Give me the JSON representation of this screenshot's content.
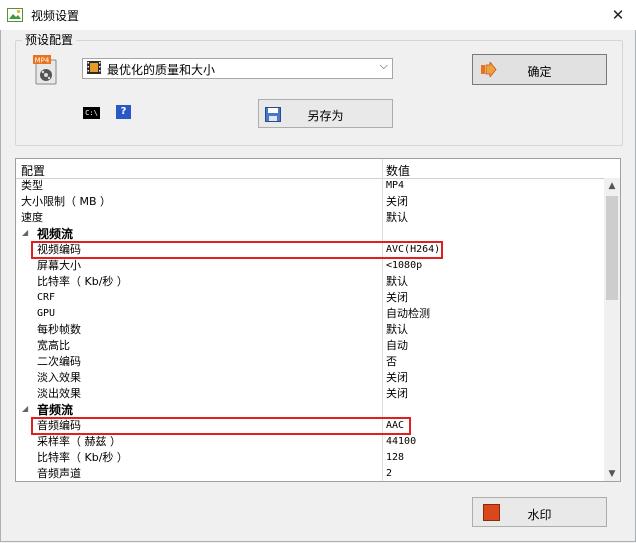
{
  "window": {
    "title": "视频设置",
    "close_glyph": "✕"
  },
  "preset": {
    "group_label": "预设配置",
    "selected": "最优化的质量和大小",
    "ok_label": "确定",
    "save_as_label": "另存为",
    "cmd_label": "C:\\",
    "help_label": "?",
    "format_icon_text": "MP4"
  },
  "table": {
    "headers": [
      "配置",
      "数值"
    ],
    "rows": [
      {
        "name": "类型",
        "value": "MP4",
        "level": 0,
        "mono": true
      },
      {
        "name": "大小限制（ MB ）",
        "value": "关闭",
        "level": 0
      },
      {
        "name": "速度",
        "value": "默认",
        "level": 0
      },
      {
        "name": "视频流",
        "value": "",
        "level": 0,
        "section": true
      },
      {
        "name": "视频编码",
        "value": "AVC(H264)",
        "level": 1,
        "mono": true,
        "highlight": true
      },
      {
        "name": "屏幕大小",
        "value": "<1080p",
        "level": 1,
        "mono": true
      },
      {
        "name": "比特率（ Kb/秒 ）",
        "value": "默认",
        "level": 1
      },
      {
        "name": "CRF",
        "value": "关闭",
        "level": 1,
        "mono_name": true
      },
      {
        "name": "GPU",
        "value": "自动检测",
        "level": 1,
        "mono_name": true
      },
      {
        "name": "每秒帧数",
        "value": "默认",
        "level": 1
      },
      {
        "name": "宽高比",
        "value": "自动",
        "level": 1
      },
      {
        "name": "二次编码",
        "value": "否",
        "level": 1
      },
      {
        "name": "淡入效果",
        "value": "关闭",
        "level": 1
      },
      {
        "name": "淡出效果",
        "value": "关闭",
        "level": 1
      },
      {
        "name": "音频流",
        "value": "",
        "level": 0,
        "section": true
      },
      {
        "name": "音频编码",
        "value": "AAC",
        "level": 1,
        "mono": true,
        "highlight": true
      },
      {
        "name": "采样率（ 赫兹 ）",
        "value": "44100",
        "level": 1,
        "mono": true
      },
      {
        "name": "比特率（ Kb/秒 ）",
        "value": "128",
        "level": 1,
        "mono": true
      },
      {
        "name": "音频声道",
        "value": "2",
        "level": 1,
        "mono": true
      }
    ]
  },
  "watermark_label": "水印",
  "colors": {
    "highlight": "#e02020",
    "accent_orange": "#e8731a"
  }
}
